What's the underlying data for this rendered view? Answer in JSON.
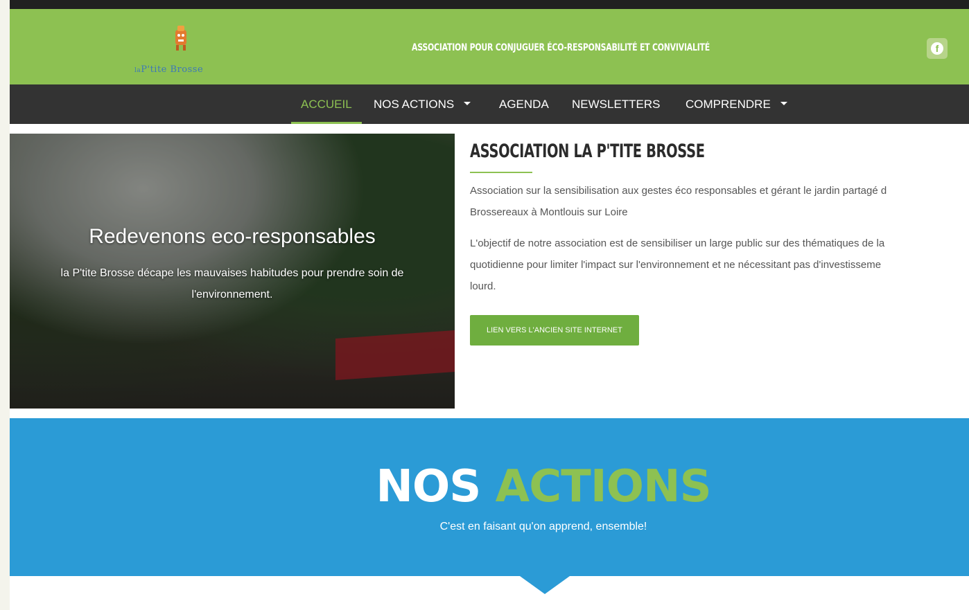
{
  "logo": {
    "name": "P'tite Brosse",
    "prefix": "la"
  },
  "header": {
    "tagline": "ASSOCIATION POUR CONJUGUER ÉCO-RESPONSABILITÉ ET CONVIVIALITÉ",
    "social_icon": "facebook-icon"
  },
  "nav": {
    "items": [
      {
        "label": "ACCUEIL",
        "active": true
      },
      {
        "label": "NOS ACTIONS",
        "dropdown": true
      },
      {
        "label": "AGENDA"
      },
      {
        "label": "NEWSLETTERS"
      },
      {
        "label": "COMPRENDRE",
        "dropdown": true
      }
    ]
  },
  "hero": {
    "title": "Redevenons eco-responsables",
    "subtitle": "la P'tite Brosse décape les mauvaises habitudes pour prendre soin de l'environnement."
  },
  "intro": {
    "title": "ASSOCIATION LA P'TITE BROSSE",
    "p1_line1": "Association sur la sensibilisation aux gestes éco responsables et gérant le jardin partagé d",
    "p1_line2": "Brossereaux à Montlouis sur Loire",
    "p2_line1": "L'objectif de notre association est de sensibiliser un large public sur des thématiques de la",
    "p2_line2": "quotidienne pour limiter l'impact sur l'environnement et ne nécessitant pas d'investisseme",
    "p2_line3": "lourd.",
    "button": "LIEN VERS L'ANCIEN SITE INTERNET"
  },
  "actions": {
    "title_white": "NOS",
    "title_green": "ACTIONS",
    "subtitle": "C'est en faisant qu'on apprend, ensemble!"
  },
  "colors": {
    "green": "#8dc152",
    "blue": "#2b9bd6",
    "nav": "#333333"
  }
}
